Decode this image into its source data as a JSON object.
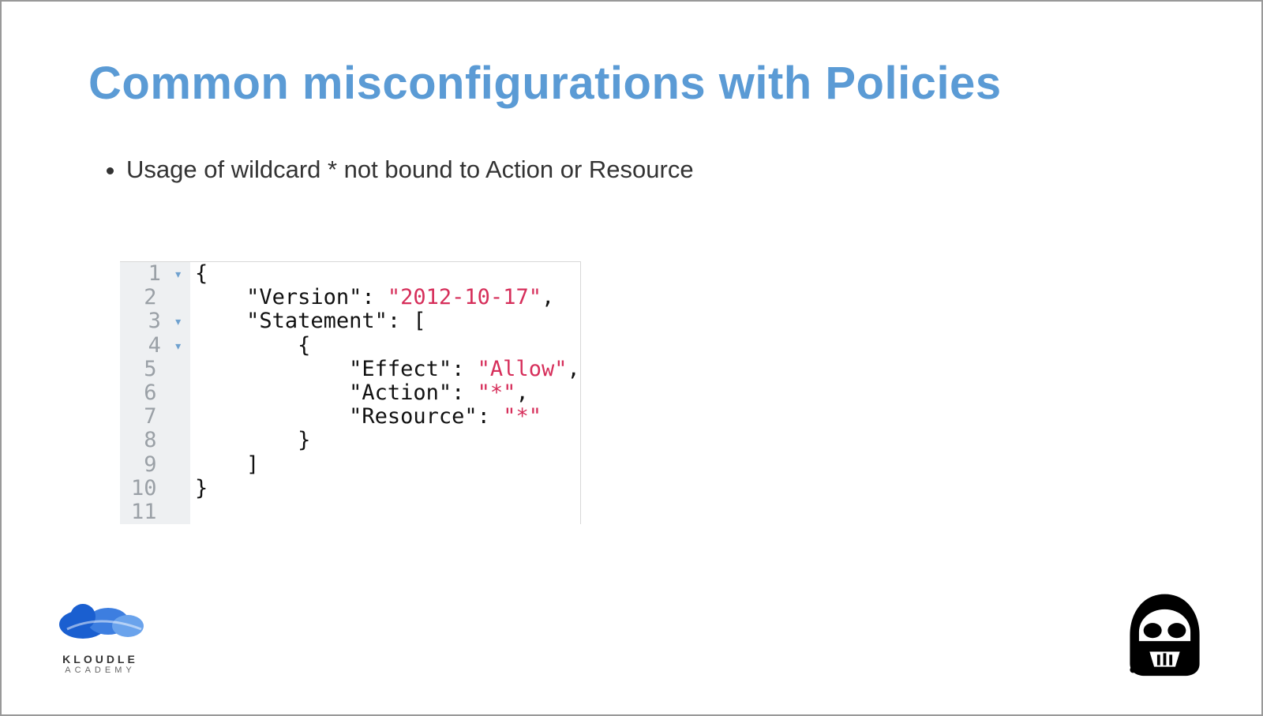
{
  "title": "Common misconfigurations with Policies",
  "bullets": [
    "Usage of wildcard * not bound to Action or Resource"
  ],
  "code": {
    "lines": [
      {
        "num": "1",
        "fold": true
      },
      {
        "num": "2",
        "fold": false
      },
      {
        "num": "3",
        "fold": true
      },
      {
        "num": "4",
        "fold": true
      },
      {
        "num": "5",
        "fold": false
      },
      {
        "num": "6",
        "fold": false
      },
      {
        "num": "7",
        "fold": false
      },
      {
        "num": "8",
        "fold": false
      },
      {
        "num": "9",
        "fold": false
      },
      {
        "num": "10",
        "fold": false
      },
      {
        "num": "11",
        "fold": false
      }
    ],
    "tokens": {
      "l1": [
        {
          "t": "{",
          "c": "punc"
        }
      ],
      "l2": [
        {
          "t": "    ",
          "c": "plain"
        },
        {
          "t": "\"Version\"",
          "c": "key"
        },
        {
          "t": ": ",
          "c": "punc"
        },
        {
          "t": "\"2012-10-17\"",
          "c": "str"
        },
        {
          "t": ",",
          "c": "punc"
        }
      ],
      "l3": [
        {
          "t": "    ",
          "c": "plain"
        },
        {
          "t": "\"Statement\"",
          "c": "key"
        },
        {
          "t": ": [",
          "c": "punc"
        }
      ],
      "l4": [
        {
          "t": "        {",
          "c": "punc"
        }
      ],
      "l5": [
        {
          "t": "            ",
          "c": "plain"
        },
        {
          "t": "\"Effect\"",
          "c": "key"
        },
        {
          "t": ": ",
          "c": "punc"
        },
        {
          "t": "\"Allow\"",
          "c": "str"
        },
        {
          "t": ",",
          "c": "punc"
        }
      ],
      "l6": [
        {
          "t": "            ",
          "c": "plain"
        },
        {
          "t": "\"Action\"",
          "c": "key"
        },
        {
          "t": ": ",
          "c": "punc"
        },
        {
          "t": "\"*\"",
          "c": "str"
        },
        {
          "t": ",",
          "c": "punc"
        }
      ],
      "l7": [
        {
          "t": "            ",
          "c": "plain"
        },
        {
          "t": "\"Resource\"",
          "c": "key"
        },
        {
          "t": ": ",
          "c": "punc"
        },
        {
          "t": "\"*\"",
          "c": "str"
        }
      ],
      "l8": [
        {
          "t": "        }",
          "c": "punc"
        }
      ],
      "l9": [
        {
          "t": "    ]",
          "c": "punc"
        }
      ],
      "l10": [
        {
          "t": "}",
          "c": "punc"
        }
      ],
      "l11": [
        {
          "t": "",
          "c": "plain"
        }
      ]
    }
  },
  "footer": {
    "brand": "KLOUDLE",
    "brand_sub": "ACADEMY"
  }
}
